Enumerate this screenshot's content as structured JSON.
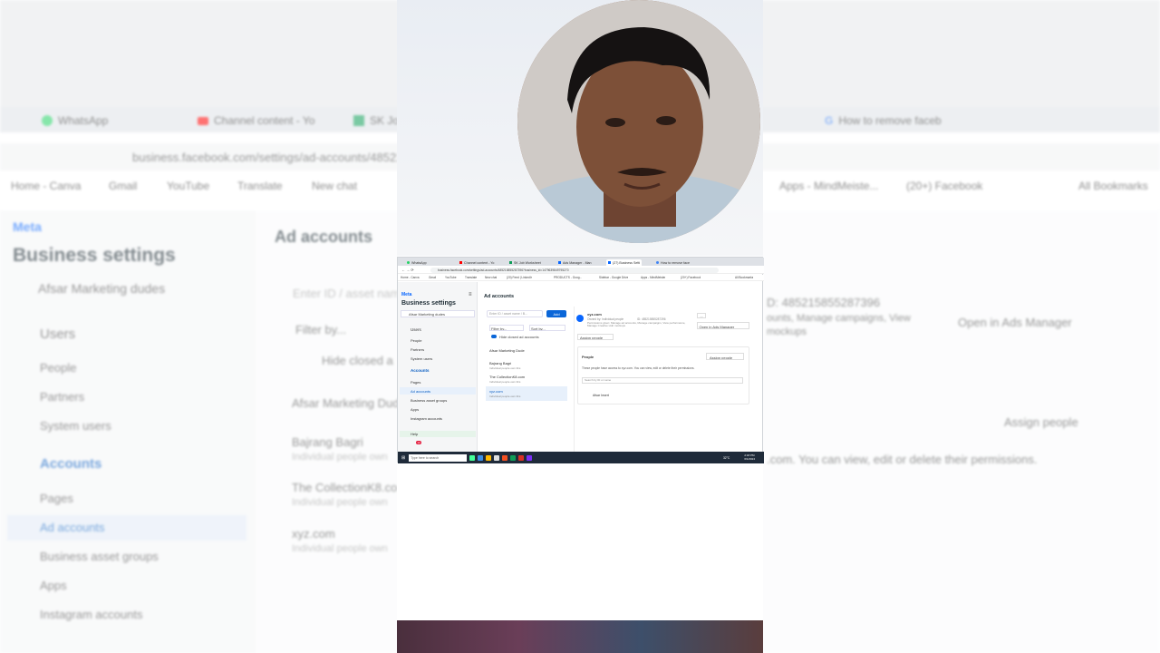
{
  "bg": {
    "tabs": [
      "WhatsApp",
      "Channel content - Yo",
      "SK Jo",
      "How to remove faceb"
    ],
    "address": "business.facebook.com/settings/ad-accounts/485215",
    "bookmarks": [
      "Home - Canva",
      "Gmail",
      "YouTube",
      "Translate",
      "New chat",
      "Apps - MindMeiste...",
      "(20+) Facebook",
      "All Bookmarks"
    ],
    "brand": "Meta",
    "title": "Business settings",
    "business_name": "Afsar Marketing dudes",
    "sections": [
      "Users",
      "Accounts"
    ],
    "user_items": [
      "People",
      "Partners",
      "System users"
    ],
    "account_items": [
      "Pages",
      "Ad accounts",
      "Business asset groups",
      "Apps",
      "Instagram accounts"
    ],
    "main_title": "Ad accounts",
    "search_placeholder": "Enter ID / asset nam",
    "filter_label": "Filter by...",
    "hide_closed": "Hide closed a",
    "list": [
      "Afsar Marketing Dud",
      "Bajrang Bagri",
      "The CollectionK8.co",
      "xyz.com"
    ],
    "list_sub": "Individual people own",
    "id_text": "D: 485215855287396",
    "perm_text": "ounts, Manage campaigns, View",
    "perm_text2": "mockups",
    "open_ads_manager": "Open in Ads Manager",
    "assign_people": "Assign people",
    "can_view": ".com. You can view, edit or delete their permissions."
  },
  "shot": {
    "tabs": [
      "WhatsApp",
      "Channel content - Yo",
      "SK Job Worksheet",
      "Ads Manager - Man",
      "(27) Business Setti",
      "How to remove face"
    ],
    "address": "business.facebook.com/settings/ad-accounts/485215855287396?business_id=1479639849795270",
    "bookmarks": [
      "Home - Canva",
      "Gmail",
      "YouTube",
      "Translate",
      "New chat",
      "(20) Feed | LinkedIn",
      "PRODUCTS - Goog...",
      "Sidebar - Google Drive",
      "Apps - MindMeister",
      "(20+) Facebook",
      "All Bookmarks"
    ],
    "brand": "Meta",
    "title": "Business settings",
    "business_name": "Afsar Marketing dudes",
    "users": "Users",
    "user_items": [
      "People",
      "Partners",
      "System users"
    ],
    "accounts": "Accounts",
    "account_items": [
      "Pages",
      "Ad accounts",
      "Business asset groups",
      "Apps",
      "Instagram accounts"
    ],
    "help": "Help",
    "main_title": "Ad accounts",
    "search_placeholder": "Enter ID / asset name / B...",
    "add": "Add",
    "filter": "Filter by...",
    "sort": "Sort by...",
    "hide_closed": "Hide closed ad accounts",
    "list": [
      {
        "name": "Afsar Marketing Dude",
        "sub": ""
      },
      {
        "name": "Bajrang Bagri",
        "sub": "Individual people own this"
      },
      {
        "name": "The CollectionK8.com",
        "sub": "Individual people own this"
      },
      {
        "name": "xyz.com",
        "sub": "Individual people own this"
      }
    ],
    "detail": {
      "name": "xyz.com",
      "owned": "Owned by: Individual people",
      "id": "ID: 485215855287396",
      "perms": "Permissions given: Manage ad accounts, Manage campaigns, View performance, Manage Creative Hub mockups",
      "assign_people_btn": "Assign people",
      "open_ads_manager": "Open in Ads Manager",
      "more": "...",
      "people_title": "People",
      "assign_people2": "Assign people",
      "people_desc": "These people have access to xyz.com. You can view, edit or delete their permissions.",
      "search_placeholder": "Search by ID or name",
      "person": "Afsar Insert"
    },
    "taskbar_search": "Type here to search",
    "taskbar_weather": "32°C",
    "taskbar_time": "2:18 PM",
    "taskbar_date": "6/1/2024",
    "notif_count": "12"
  }
}
